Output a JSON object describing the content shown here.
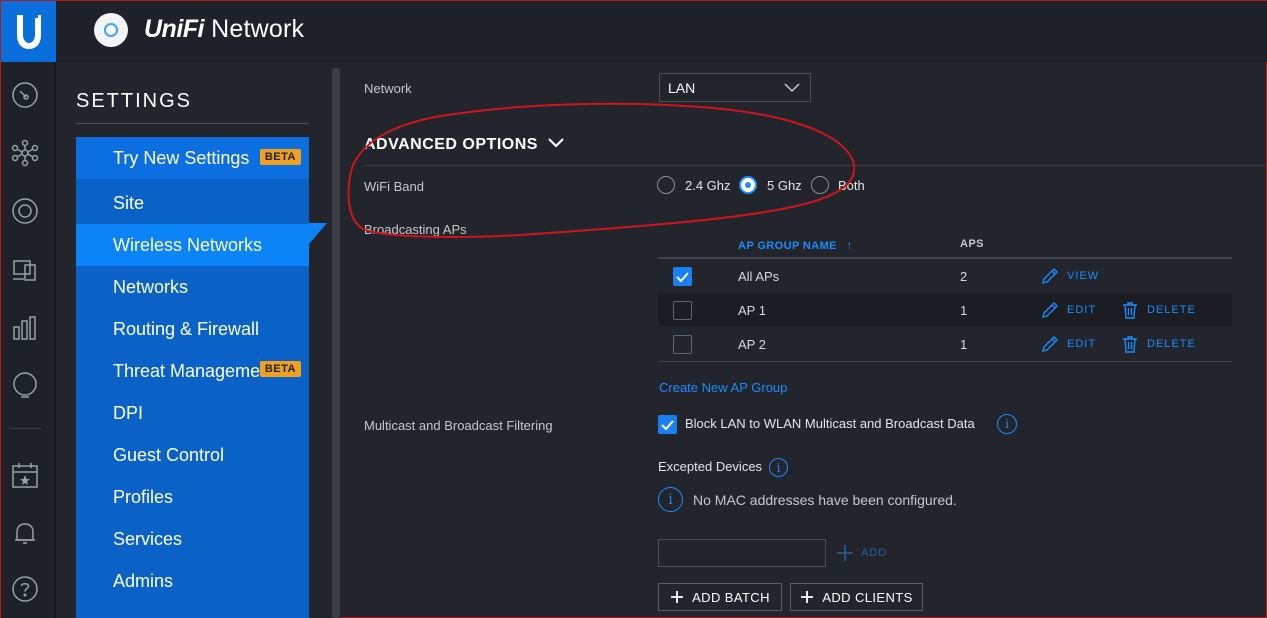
{
  "app": {
    "brand_prefix": "UniFi",
    "brand_suffix": " Network"
  },
  "settings": {
    "title": "SETTINGS",
    "menu": [
      {
        "label": "Try New Settings",
        "badge": "BETA"
      },
      {
        "label": "Site"
      },
      {
        "label": "Wireless Networks"
      },
      {
        "label": "Networks"
      },
      {
        "label": "Routing & Firewall"
      },
      {
        "label": "Threat Management",
        "badge": "BETA"
      },
      {
        "label": "DPI"
      },
      {
        "label": "Guest Control"
      },
      {
        "label": "Profiles"
      },
      {
        "label": "Services"
      },
      {
        "label": "Admins"
      }
    ]
  },
  "form": {
    "network_label": "Network",
    "network_value": "LAN",
    "advanced_title": "ADVANCED OPTIONS",
    "wifi_band_label": "WiFi Band",
    "bands": [
      {
        "label": "2.4 Ghz",
        "selected": false
      },
      {
        "label": "5 Ghz",
        "selected": true
      },
      {
        "label": "Both",
        "selected": false
      }
    ],
    "broadcasting_label": "Broadcasting APs",
    "table": {
      "col_name": "AP GROUP NAME",
      "sort_arrow": "↑",
      "col_aps": "APS",
      "rows": [
        {
          "name": "All APs",
          "aps": "2",
          "checked": true,
          "primary_action": "VIEW",
          "delete": ""
        },
        {
          "name": "AP 1",
          "aps": "1",
          "checked": false,
          "primary_action": "EDIT",
          "delete": "DELETE"
        },
        {
          "name": "AP 2",
          "aps": "1",
          "checked": false,
          "primary_action": "EDIT",
          "delete": "DELETE"
        }
      ]
    },
    "create_group_link": "Create New AP Group",
    "multicast_label": "Multicast and Broadcast Filtering",
    "block_multicast_label": "Block LAN to WLAN Multicast and Broadcast Data",
    "excepted_devices_label": "Excepted Devices",
    "no_mac_message": "No MAC addresses have been configured.",
    "add_inline_label": "ADD",
    "add_batch_label": "ADD BATCH",
    "add_clients_label": "ADD CLIENTS"
  },
  "colors": {
    "accent": "#1a8cff",
    "sidebar": "#0a62c7",
    "active": "#0b84f7",
    "badge": "#f0a020",
    "annotation": "#d0141c"
  }
}
